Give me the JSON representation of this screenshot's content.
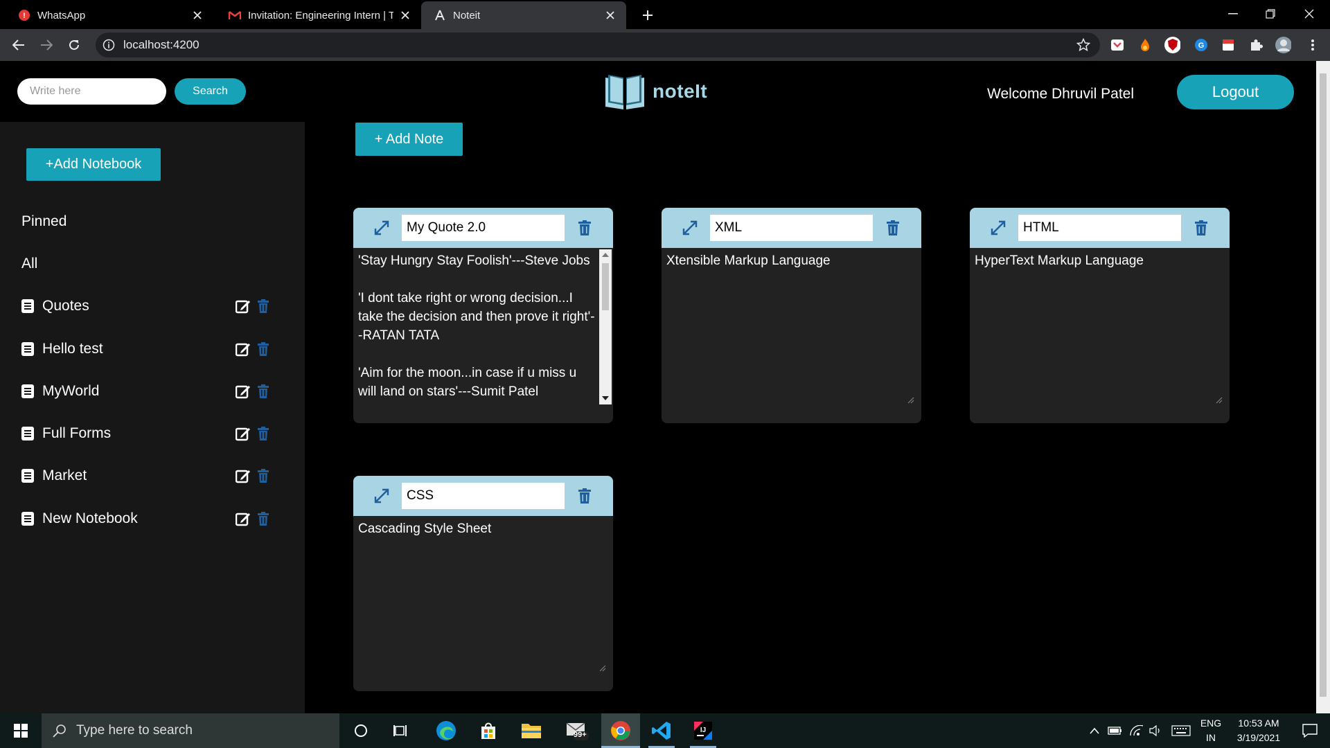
{
  "browser": {
    "tabs": [
      {
        "title": "WhatsApp",
        "favicon": "whatsapp-icon"
      },
      {
        "title": "Invitation: Engineering Intern | Te",
        "favicon": "gmail-icon"
      },
      {
        "title": "Noteit",
        "favicon": "angular-icon"
      }
    ],
    "url": "localhost:4200"
  },
  "header": {
    "search_placeholder": "Write here",
    "search_label": "Search",
    "brand": "noteIt",
    "welcome": "Welcome Dhruvil Patel",
    "logout_label": "Logout"
  },
  "sidebar": {
    "add_notebook_label": "+Add Notebook",
    "pinned_label": "Pinned",
    "all_label": "All",
    "notebooks": [
      "Quotes",
      "Hello test",
      "MyWorld",
      "Full Forms",
      "Market",
      "New Notebook"
    ]
  },
  "main": {
    "add_note_label": "+ Add Note",
    "notes": [
      {
        "title": "My Quote 2.0",
        "body": "'Stay Hungry Stay Foolish'---Steve Jobs\n\n'I dont take right or wrong decision...I take the decision and then prove it right'--RATAN TATA\n\n'Aim for the moon...in case if u miss u will land on stars'---Sumit Patel"
      },
      {
        "title": "XML",
        "body": "Xtensible Markup Language"
      },
      {
        "title": "HTML",
        "body": "HyperText Markup Language"
      },
      {
        "title": "CSS",
        "body": "Cascading Style Sheet"
      }
    ]
  },
  "taskbar": {
    "search_placeholder": "Type here to search",
    "mail_badge": "99+",
    "lang_line1": "ENG",
    "lang_line2": "IN",
    "time": "10:53 AM",
    "date": "3/19/2021"
  },
  "colors": {
    "accent": "#17a2b8",
    "card_header": "#a9d4e3",
    "card_body": "#222222",
    "sidebar_bg": "#171717",
    "trash_blue": "#1f5f9e"
  }
}
